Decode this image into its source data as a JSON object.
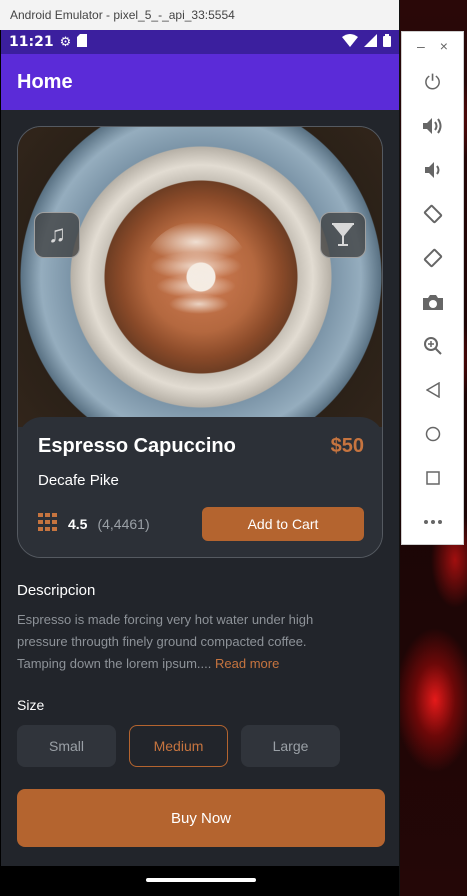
{
  "window": {
    "title": "Android Emulator - pixel_5_-_api_33:5554"
  },
  "status_bar": {
    "time": "11:21",
    "settings_icon": "gear-icon",
    "storage_icon": "sd-card-icon",
    "wifi_icon": "wifi-icon",
    "signal_icon": "signal-icon",
    "battery_icon": "battery-icon"
  },
  "app_bar": {
    "title": "Home"
  },
  "product": {
    "left_icon": "music-note-icon",
    "right_icon": "cocktail-glass-icon",
    "name": "Espresso Capuccino",
    "price": "$50",
    "subtitle": "Decafe Pike",
    "rating": "4.5",
    "rating_count": "(4,4461)",
    "add_to_cart": "Add to Cart"
  },
  "description": {
    "title": "Descripcion",
    "text": "Espresso is made forcing very hot water under high pressure througth finely ground compacted coffee. Tamping down the lorem ipsum....",
    "read_more": "Read more"
  },
  "size": {
    "title": "Size",
    "options": [
      "Small",
      "Medium",
      "Large"
    ],
    "selected": "Medium"
  },
  "buy_now": "Buy Now",
  "toolbar": {
    "minimize": "–",
    "close": "×",
    "items": [
      "power-icon",
      "volume-up-icon",
      "volume-down-icon",
      "rotate-left-icon",
      "rotate-right-icon",
      "camera-icon",
      "zoom-icon",
      "back-icon",
      "home-icon",
      "overview-icon",
      "more-icon"
    ]
  },
  "colors": {
    "accent": "#b4642f",
    "app_bar": "#5b2bd8",
    "status_bar": "#3b1f9e",
    "background": "#22252b"
  }
}
